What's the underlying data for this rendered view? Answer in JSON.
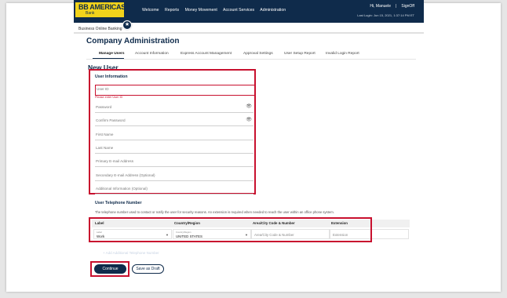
{
  "header": {
    "brand": "BB AMERICAS",
    "brand_sub": "Bank",
    "nav": [
      "Welcome",
      "Reports",
      "Money Movement",
      "Account Services",
      "Administration"
    ],
    "greeting": "Hi, Manuele",
    "signoff": "SignOff",
    "last_login": "Last Login: Jun 15, 2021, 1:37:14 PM ET"
  },
  "breadcrumb": "Business Online Banking",
  "page_title": "Company Administration",
  "tabs": [
    {
      "label": "Manage Users",
      "active": true
    },
    {
      "label": "Account Information"
    },
    {
      "label": "Express Account Management"
    },
    {
      "label": "Approval Settings"
    },
    {
      "label": "User Setup Report"
    },
    {
      "label": "Invalid Login Report"
    }
  ],
  "form": {
    "heading": "New User",
    "user_info_heading": "User Information",
    "user_id_label": "User ID",
    "user_id_error": "Please enter User ID",
    "password_label": "Password",
    "confirm_password_label": "Confirm Password",
    "first_name_label": "First Name",
    "last_name_label": "Last Name",
    "primary_email_label": "Primary E-mail Address",
    "secondary_email_label": "Secondary E-mail Address (Optional)",
    "additional_info_label": "Additional Information (Optional)"
  },
  "telephone": {
    "heading": "User Telephone Number",
    "description": "The telephone number used to contact or notify the user for security reasons. An extension is required when needed to reach the user within an office phone system.",
    "columns": [
      "Label",
      "Country/Region",
      "Area/City Code & Number",
      "Extension"
    ],
    "row": {
      "label_small": "Label",
      "label_value": "Work",
      "country_small": "Country/Region",
      "country_value": "UNITED STATES",
      "number_placeholder": "Area/City Code & Number",
      "extension_placeholder": "Extension"
    },
    "add_link": "+ Add Additional Telephone Number"
  },
  "buttons": {
    "continue": "Continue",
    "save_draft": "Save as Draft"
  },
  "colors": {
    "navy": "#0f2b4b",
    "brand_yellow": "#f2d31b",
    "highlight_red": "#c8102e"
  }
}
